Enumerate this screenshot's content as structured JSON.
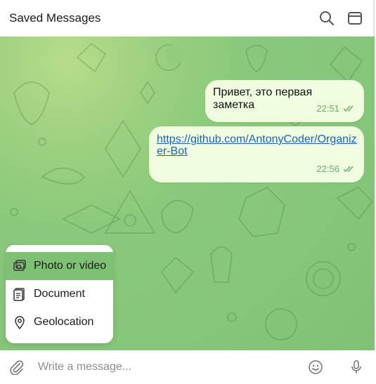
{
  "header": {
    "title": "Saved Messages",
    "icons": [
      "search-icon",
      "layout-icon"
    ]
  },
  "messages": [
    {
      "text": "Привет, это первая заметка",
      "time": "22:51",
      "status": "read"
    },
    {
      "text": "https://github.com/AntonyCoder/Organizer-Bot",
      "time": "22:56",
      "status": "read",
      "is_link": true
    }
  ],
  "attach_menu": {
    "items": [
      {
        "label": "Photo or video",
        "icon": "photo-video-icon",
        "active": true
      },
      {
        "label": "Document",
        "icon": "document-icon",
        "active": false
      },
      {
        "label": "Geolocation",
        "icon": "location-pin-icon",
        "active": false
      }
    ]
  },
  "composer": {
    "placeholder": "Write a message...",
    "icons": [
      "paperclip-icon",
      "emoji-icon",
      "microphone-icon"
    ]
  },
  "colors": {
    "bubble": "#effdde",
    "accent_green": "#7fc174",
    "link": "#1a64b5",
    "meta": "#6fa96f"
  }
}
